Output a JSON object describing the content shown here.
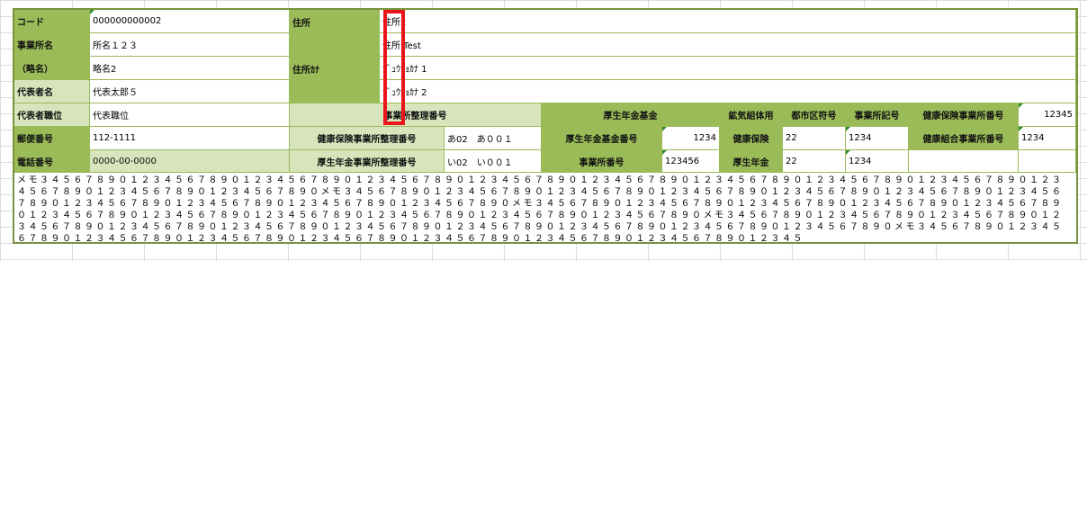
{
  "form": {
    "code_label": "コード",
    "code_value": "000000000002",
    "office_name_label": "事業所名",
    "office_name_value": "所名１２３",
    "abbr_label": "（略名）",
    "abbr_value": "略名2",
    "rep_label": "代表者名",
    "rep_value": "代表太郎５",
    "rep_title_label": "代表者職位",
    "rep_title_value": "代表職位",
    "postal_label": "郵便番号",
    "postal_value": "112-1111",
    "phone_label": "電話番号",
    "phone_value": "0000-00-0000",
    "address_label": "住所",
    "address1_value": "住所2",
    "address2_value": "住所 Test",
    "address_kana_label": "住所ｶﾅ",
    "address_kana1_value": "ｼﾞｭｳｼｮｶﾅ 1",
    "address_kana2_value": "ｼﾞｭｳｼｮｶﾅ 2",
    "office_ref_label": "事業所整理番号",
    "health_ins_ref_label": "健康保険事業所整理番号",
    "health_ins_ref_value": "あ02　あ００１",
    "pension_ref_label": "厚生年金事業所整理番号",
    "pension_ref_value": "い02　い００１",
    "pension_fund_label": "厚生年金基金",
    "pension_fund_no_label": "厚生年金基金番号",
    "pension_fund_no_value": "1234",
    "office_no_label": "事業所番号",
    "office_no_value": "123456",
    "mining_label": "鉱気組体用",
    "pref_code_label": "都市区符号",
    "office_symbol_label": "事業所記号",
    "health_ins_label": "健康保険",
    "health_ins_pref_value": "22",
    "health_ins_symbol_value": "1234",
    "pension_label": "厚生年金",
    "pension_pref_value": "22",
    "pension_symbol_value": "1234",
    "health_office_no_label": "健康保険事業所番号",
    "health_office_no_value": "12345",
    "health_union_no_label": "健康組合事業所番号",
    "health_union_no_value": "1234",
    "memo_value": "メモ３４５６７８９０１２３４５６７８９０１２３４５６７８９０１２３４５６７８９０１２３４５６７８９０１２３４５６７８９０１２３４５６７８９０１２３４５６７８９０１２３４５６７８９０１２３４５６７８９０１２３４５６７８９０１２３４５６７８９０メモ３４５６７８９０１２３４５６７８９０１２３４５６７８９０１２３４５６７８９０１２３４５６７８９０１２３４５６７８９０１２３４５６７８９０１２３４５６７８９０１２３４５６７８９０１２３４５６７８９０１２３４５６７８９０メモ３４５６７８９０１２３４５６７８９０１２３４５６７８９０１２３４５６７８９０１２３４５６７８９０１２３４５６７８９０１２３４５６７８９０１２３４５６７８９０１２３４５６７８９０１２３４５６７８９０１２３４５６７８９０メモ３４５６７８９０１２３４５６７８９０１２３４５６７８９０１２３４５６７８９０１２３４５６７８９０１２３４５６７８９０１２３４５６７８９０１２３４５６７８９０１２３４５６７８９０１２３４５６７８９０１２３４５６７８９０メモ３４５６７８９０１２３４５６７８９０１２３４５６７８９０１２３４５６７８９０１２３４５６７８９０１２３４５６７８９０１２３４５６７８９０１２３４５６７８９０１２３４５"
  }
}
